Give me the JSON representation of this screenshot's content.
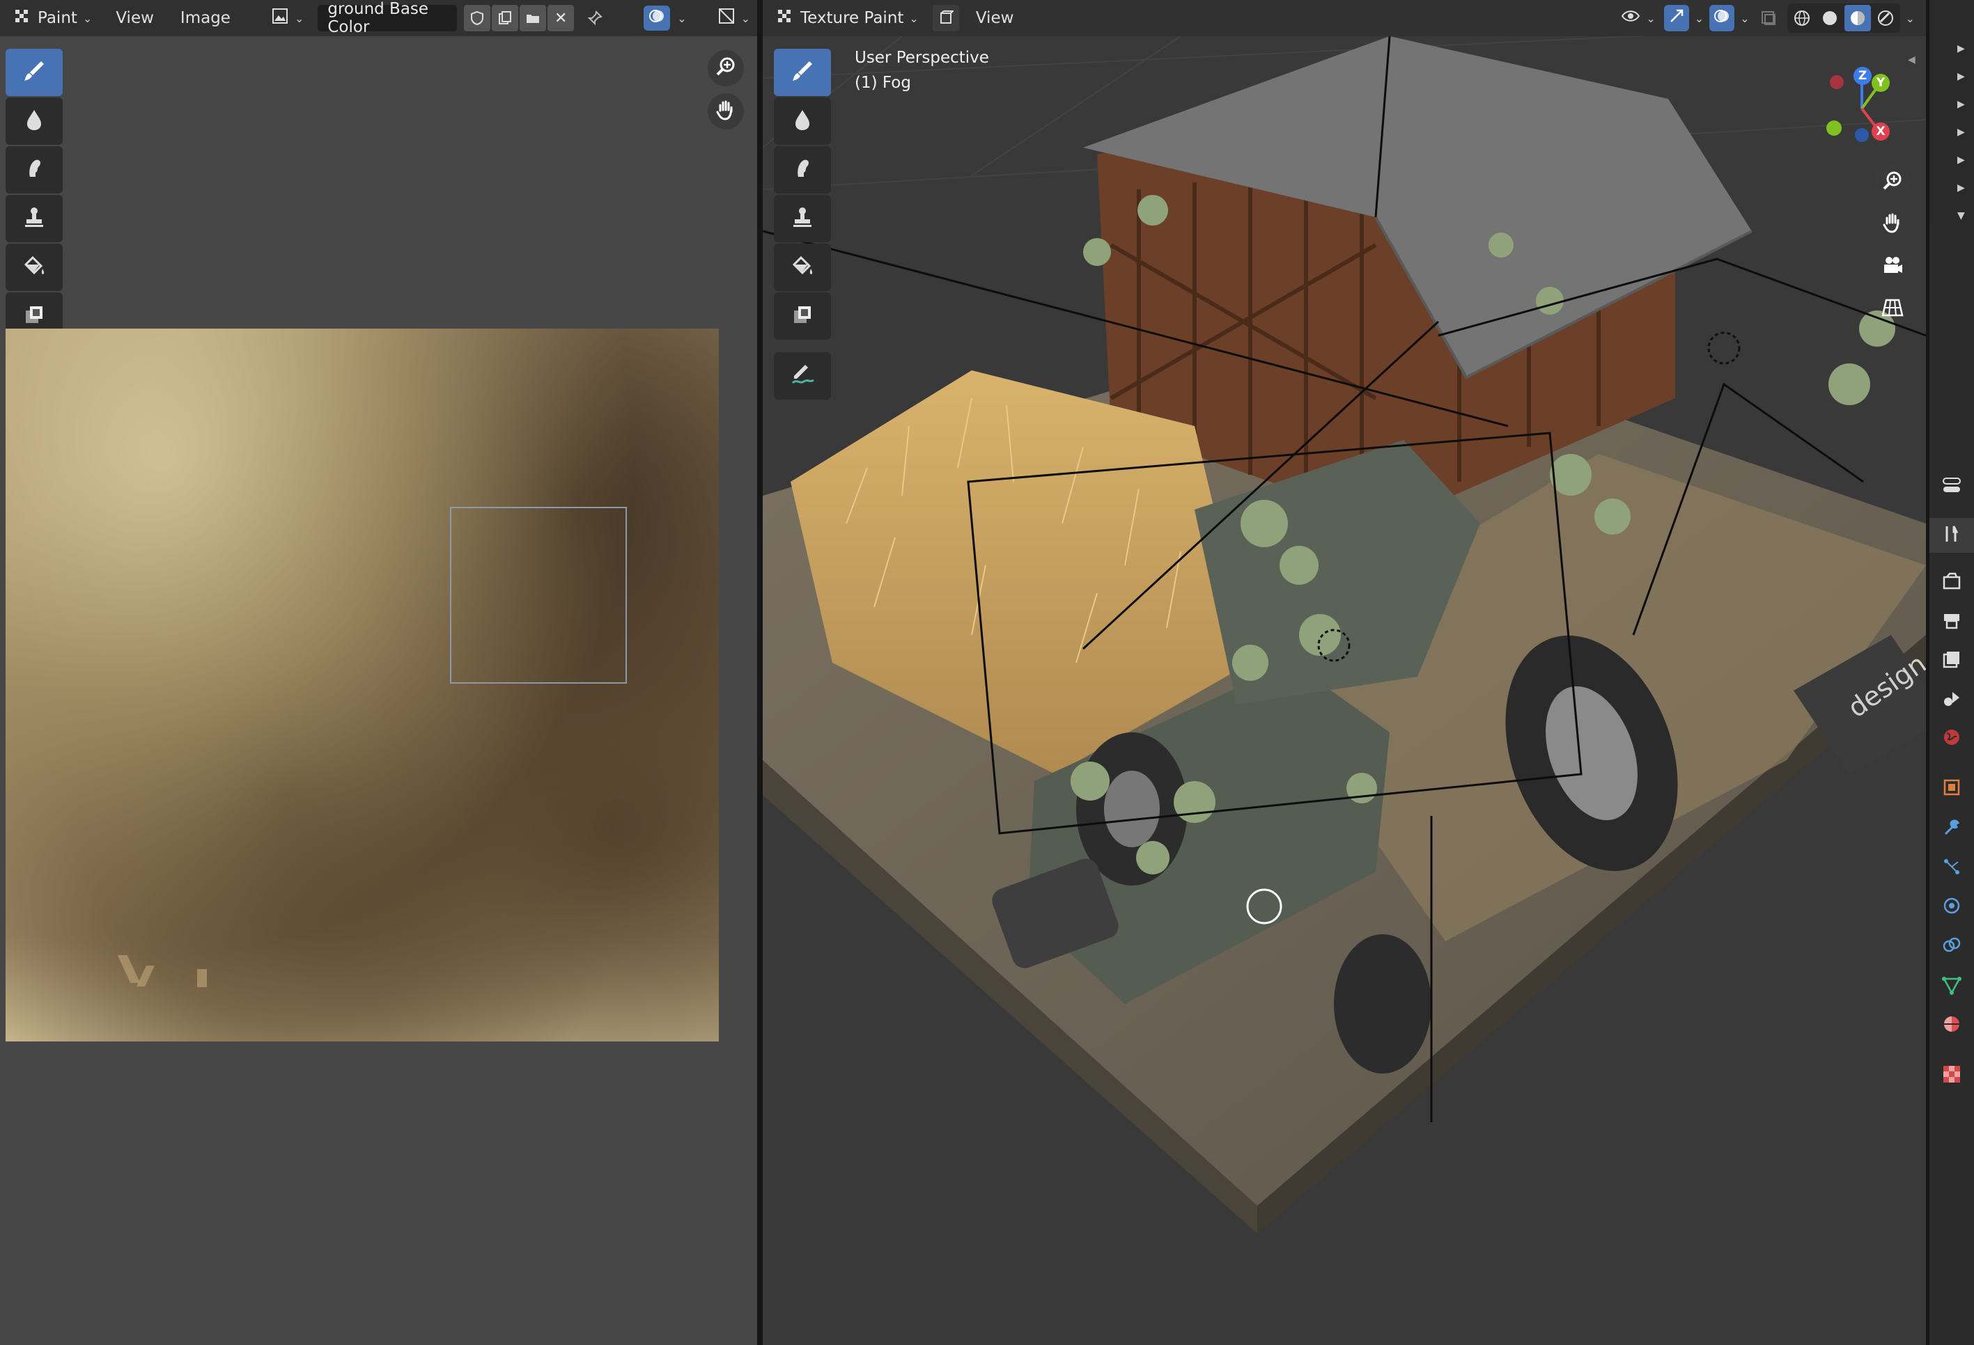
{
  "left_editor": {
    "mode_label": "Paint",
    "menus": [
      "View",
      "Image"
    ],
    "image_name": "ground Base Color"
  },
  "right_editor": {
    "mode_label": "Texture Paint",
    "menus": [
      "View"
    ],
    "overlay_title": "User Perspective",
    "overlay_subtitle": "(1) Fog",
    "watermark": "design"
  },
  "gizmo": {
    "z": "Z",
    "y": "Y",
    "x": "X"
  },
  "icons": {
    "editor_type": "checker-paint-icon",
    "tools": [
      "draw-brush-icon",
      "soften-icon",
      "smear-icon",
      "clone-icon",
      "fill-icon",
      "mask-icon",
      "annotate-icon"
    ],
    "nav": [
      "zoom-icon",
      "pan-hand-icon",
      "camera-icon",
      "grid-icon"
    ],
    "properties_tabs": [
      "tool-icon",
      "render-icon",
      "output-icon",
      "view-layer-icon",
      "scene-icon",
      "world-icon",
      "object-icon",
      "modifier-icon",
      "particles-icon",
      "physics-icon",
      "constraints-icon",
      "data-icon",
      "material-icon",
      "texture-icon"
    ]
  },
  "colors": {
    "accent": "#4772b3",
    "axis_x": "#e0404f",
    "axis_y": "#80c020",
    "axis_z": "#3b7ded"
  }
}
